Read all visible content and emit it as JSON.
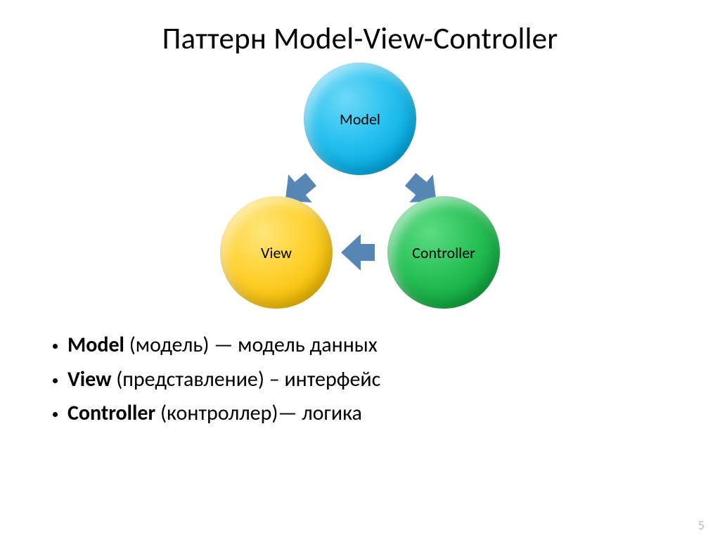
{
  "title": "Паттерн Model-View-Controller",
  "diagram": {
    "nodes": {
      "model": "Model",
      "view": "View",
      "controller": "Controller"
    },
    "arrows": [
      "model-to-view",
      "controller-to-view",
      "model-to-controller"
    ],
    "colors": {
      "model": "#00aee5",
      "view": "#f5bc00",
      "controller": "#12a848",
      "arrow": "#4e7fb1"
    }
  },
  "bullets": [
    {
      "term": "Model",
      "paren": " (модель) — модель данных"
    },
    {
      "term": "View",
      "paren": " (представление) – интерфейс"
    },
    {
      "term": "Controller",
      "paren": " (контроллер)— логика"
    }
  ],
  "page_number": "5"
}
